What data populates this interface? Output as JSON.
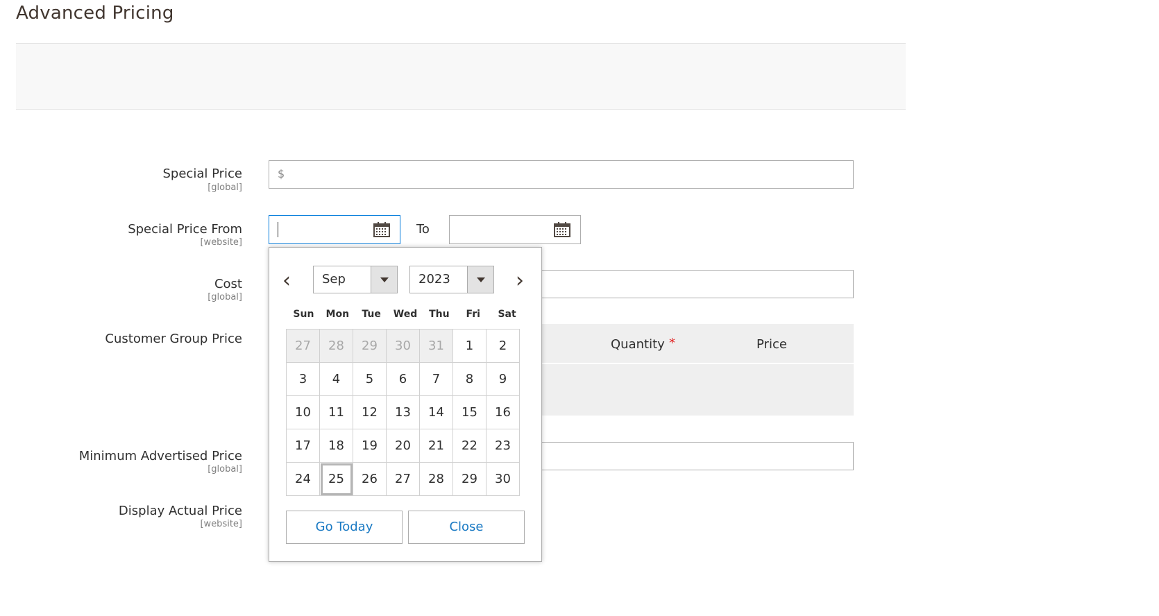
{
  "page": {
    "title": "Advanced Pricing"
  },
  "fields": {
    "special_price": {
      "label": "Special Price",
      "scope": "[global]",
      "currency": "$",
      "value": ""
    },
    "special_price_from": {
      "label": "Special Price From",
      "scope": "[website]",
      "value": "",
      "to_label": "To",
      "to_value": ""
    },
    "cost": {
      "label": "Cost",
      "scope": "[global]"
    },
    "customer_group_price": {
      "label": "Customer Group Price",
      "columns": [
        "Quantity",
        "Price"
      ],
      "required_mark": "*"
    },
    "minimum_advertised_price": {
      "label": "Minimum Advertised Price",
      "scope": "[global]"
    },
    "display_actual_price": {
      "label": "Display Actual Price",
      "scope": "[website]"
    }
  },
  "datepicker": {
    "prev_glyph": "‹",
    "next_glyph": "›",
    "month": "Sep",
    "year": "2023",
    "weekdays": [
      "Sun",
      "Mon",
      "Tue",
      "Wed",
      "Thu",
      "Fri",
      "Sat"
    ],
    "weeks": [
      [
        {
          "d": "27",
          "other": true
        },
        {
          "d": "28",
          "other": true
        },
        {
          "d": "29",
          "other": true
        },
        {
          "d": "30",
          "other": true
        },
        {
          "d": "31",
          "other": true
        },
        {
          "d": "1"
        },
        {
          "d": "2"
        }
      ],
      [
        {
          "d": "3"
        },
        {
          "d": "4"
        },
        {
          "d": "5"
        },
        {
          "d": "6"
        },
        {
          "d": "7"
        },
        {
          "d": "8"
        },
        {
          "d": "9"
        }
      ],
      [
        {
          "d": "10"
        },
        {
          "d": "11"
        },
        {
          "d": "12"
        },
        {
          "d": "13"
        },
        {
          "d": "14"
        },
        {
          "d": "15"
        },
        {
          "d": "16"
        }
      ],
      [
        {
          "d": "17"
        },
        {
          "d": "18"
        },
        {
          "d": "19"
        },
        {
          "d": "20"
        },
        {
          "d": "21"
        },
        {
          "d": "22"
        },
        {
          "d": "23"
        }
      ],
      [
        {
          "d": "24"
        },
        {
          "d": "25",
          "today": true
        },
        {
          "d": "26"
        },
        {
          "d": "27"
        },
        {
          "d": "28"
        },
        {
          "d": "29"
        },
        {
          "d": "30"
        }
      ]
    ],
    "go_today_label": "Go Today",
    "close_label": "Close"
  },
  "colors": {
    "link_blue": "#1979c3",
    "required_red": "#e22626",
    "focus_border": "#007bdb"
  }
}
